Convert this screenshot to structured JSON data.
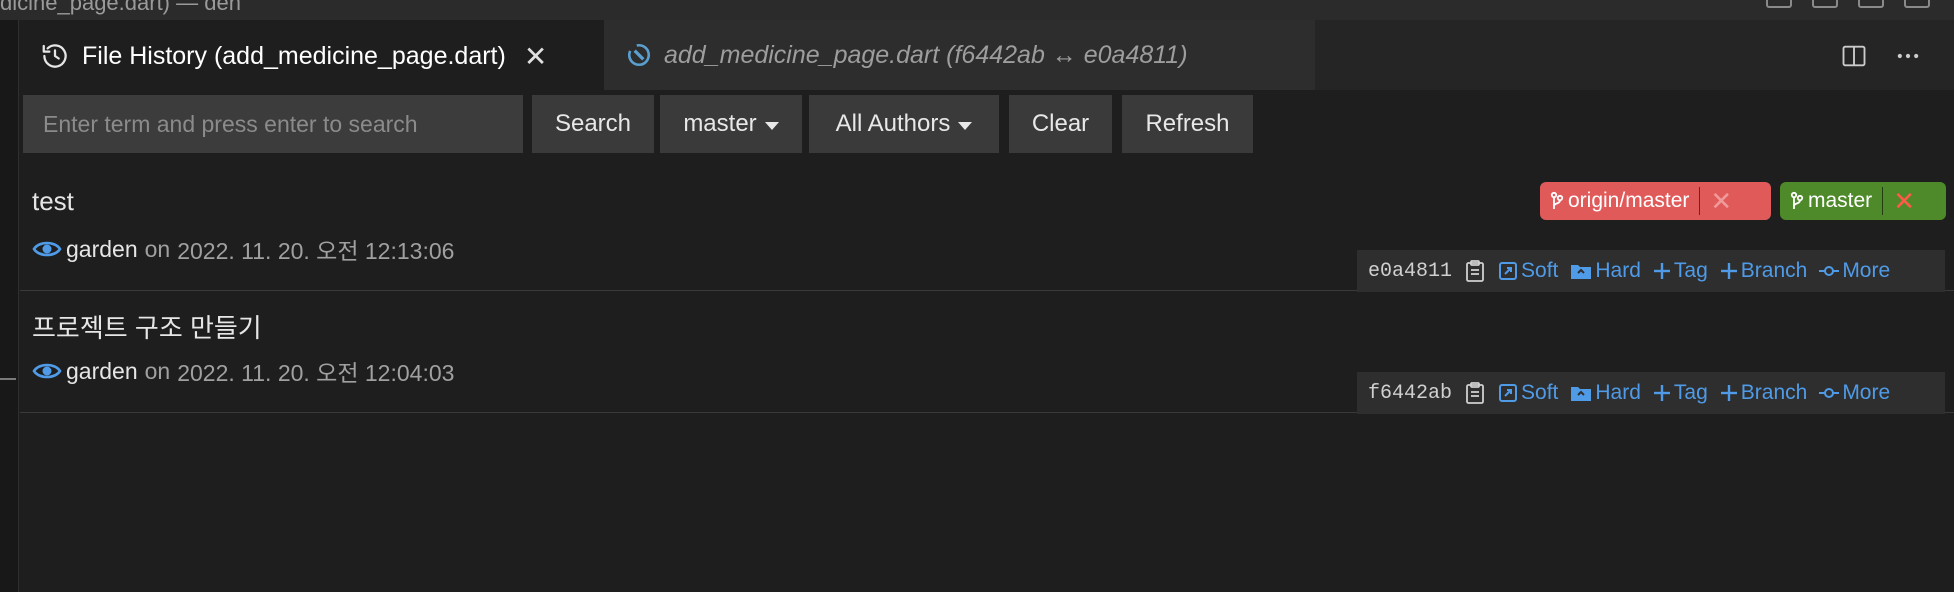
{
  "window": {
    "title_fragment": "dicine_page.dart) — den"
  },
  "tabs": [
    {
      "label": "File History (add_medicine_page.dart)",
      "icon": "history-icon",
      "active": true
    },
    {
      "label": "add_medicine_page.dart (f6442ab ↔ e0a4811)",
      "icon": "dart-file-icon",
      "active": false
    }
  ],
  "toolbar": {
    "search_placeholder": "Enter term and press enter to search",
    "search_label": "Search",
    "branch_label": "master",
    "authors_label": "All Authors",
    "clear_label": "Clear",
    "refresh_label": "Refresh"
  },
  "commits": [
    {
      "message": "test",
      "author": "garden",
      "on": "on",
      "date": "2022. 11. 20. 오전 12:13:06",
      "hash": "e0a4811",
      "refs": [
        {
          "label": "origin/master",
          "color": "#e05a5a",
          "x_color": "#f09a9a"
        },
        {
          "label": "master",
          "color": "#4e8a2a",
          "x_color": "#ff5a4a"
        }
      ]
    },
    {
      "message": "프로젝트 구조 만들기",
      "author": "garden",
      "on": "on",
      "date": "2022. 11. 20. 오전 12:04:03",
      "hash": "f6442ab",
      "refs": []
    }
  ],
  "actions": {
    "soft": "Soft",
    "hard": "Hard",
    "tag": "Tag",
    "branch": "Branch",
    "more": "More"
  },
  "colors": {
    "link": "#4f9be8",
    "background": "#1e1e1e",
    "tabbar": "#252526"
  }
}
